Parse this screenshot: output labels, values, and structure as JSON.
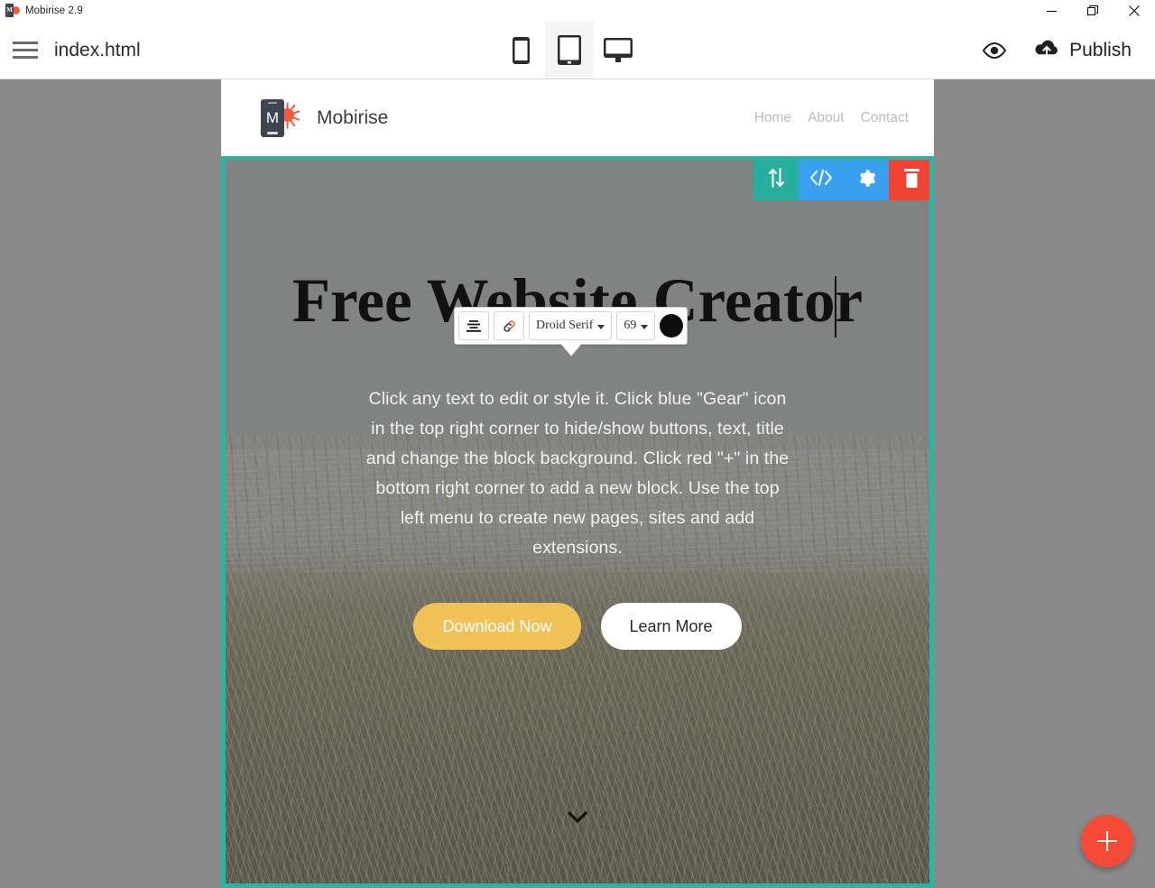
{
  "window": {
    "app_title": "Mobirise 2.9",
    "app_icon": "mobirise-logo-icon",
    "minimize_label": "minimize-icon",
    "maximize_label": "restore-icon",
    "close_label": "close-icon"
  },
  "toolbar": {
    "menu_icon": "hamburger-icon",
    "filename": "index.html",
    "devices": [
      {
        "name": "mobile",
        "icon": "mobile-icon",
        "active": false
      },
      {
        "name": "tablet",
        "icon": "tablet-icon",
        "active": true
      },
      {
        "name": "desktop",
        "icon": "desktop-icon",
        "active": false
      }
    ],
    "preview_icon": "eye-icon",
    "publish_icon": "cloud-upload-icon",
    "publish_label": "Publish"
  },
  "site": {
    "brand": "Mobirise",
    "brand_letter": "M",
    "nav": [
      "Home",
      "About",
      "Contact"
    ]
  },
  "hero": {
    "title_before_caret": "Free Website Creato",
    "title_after_caret": "r",
    "paragraph": "Click any text to edit or style it. Click blue \"Gear\" icon in the top right corner to hide/show buttons, text, title and change the block background. Click red \"+\" in the bottom right corner to add a new block. Use the top left menu to create new pages, sites and add extensions.",
    "buttons": [
      {
        "label": "Download Now",
        "style": "primary"
      },
      {
        "label": "Learn More",
        "style": "ghost"
      }
    ],
    "scroll_icon": "chevron-down-icon"
  },
  "block_tools": [
    {
      "name": "move-block",
      "icon": "arrows-up-down-icon",
      "color": "#27ae9c"
    },
    {
      "name": "edit-code",
      "icon": "code-icon",
      "color": "#38a0ef"
    },
    {
      "name": "block-settings",
      "icon": "gear-icon",
      "color": "#38a0ef"
    },
    {
      "name": "delete-block",
      "icon": "trash-icon",
      "color": "#ef4434"
    }
  ],
  "text_toolbar": {
    "align_icon": "align-center-icon",
    "link_icon": "link-icon",
    "font_family": "Droid Serif",
    "font_size": "69",
    "color_swatch": "#0d0d0d"
  },
  "fab": {
    "icon": "plus-icon"
  },
  "colors": {
    "selection_border": "#2bb3a3",
    "accent_red": "#f44a36",
    "accent_blue": "#38a0ef",
    "accent_teal": "#27ae9c",
    "cta_yellow": "#efc157",
    "brand_orange": "#ef5b3c"
  }
}
